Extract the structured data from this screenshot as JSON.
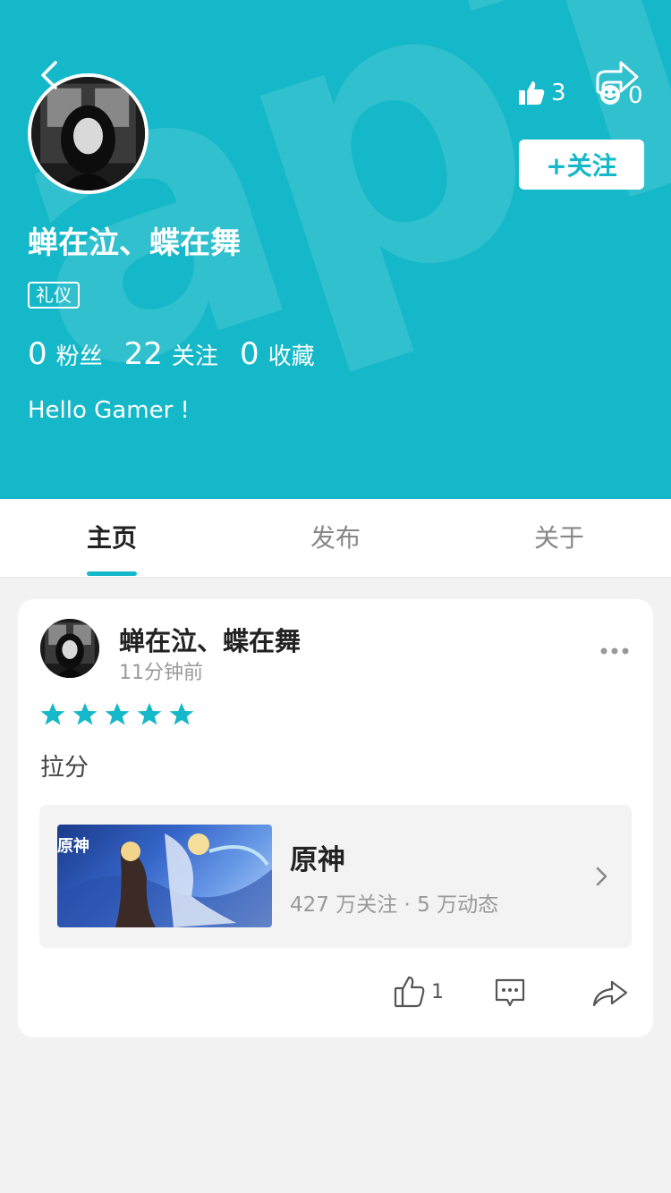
{
  "brand": {
    "accent": "#15b8c8",
    "watermark": "apTap"
  },
  "profile": {
    "name": "蝉在泣、蝶在舞",
    "tag": "礼仪",
    "bio": "Hello Gamer !",
    "follow_label": "+关注",
    "likes": "3",
    "shares": "0",
    "stats": [
      {
        "num": "0",
        "label": "粉丝"
      },
      {
        "num": "22",
        "label": "关注"
      },
      {
        "num": "0",
        "label": "收藏"
      }
    ]
  },
  "tabs": [
    {
      "label": "主页",
      "active": true
    },
    {
      "label": "发布",
      "active": false
    },
    {
      "label": "关于",
      "active": false
    }
  ],
  "post": {
    "author": "蝉在泣、蝶在舞",
    "time": "11分钟前",
    "rating": 5,
    "text": "拉分",
    "game": {
      "cover_text": "原神",
      "title": "原神",
      "stats": "427 万关注 · 5 万动态"
    },
    "likes": "1"
  },
  "icons": [
    "back-icon",
    "thumbs-up-icon",
    "share-icon",
    "star-icon",
    "more-icon",
    "chevron-right-icon",
    "comment-icon"
  ]
}
